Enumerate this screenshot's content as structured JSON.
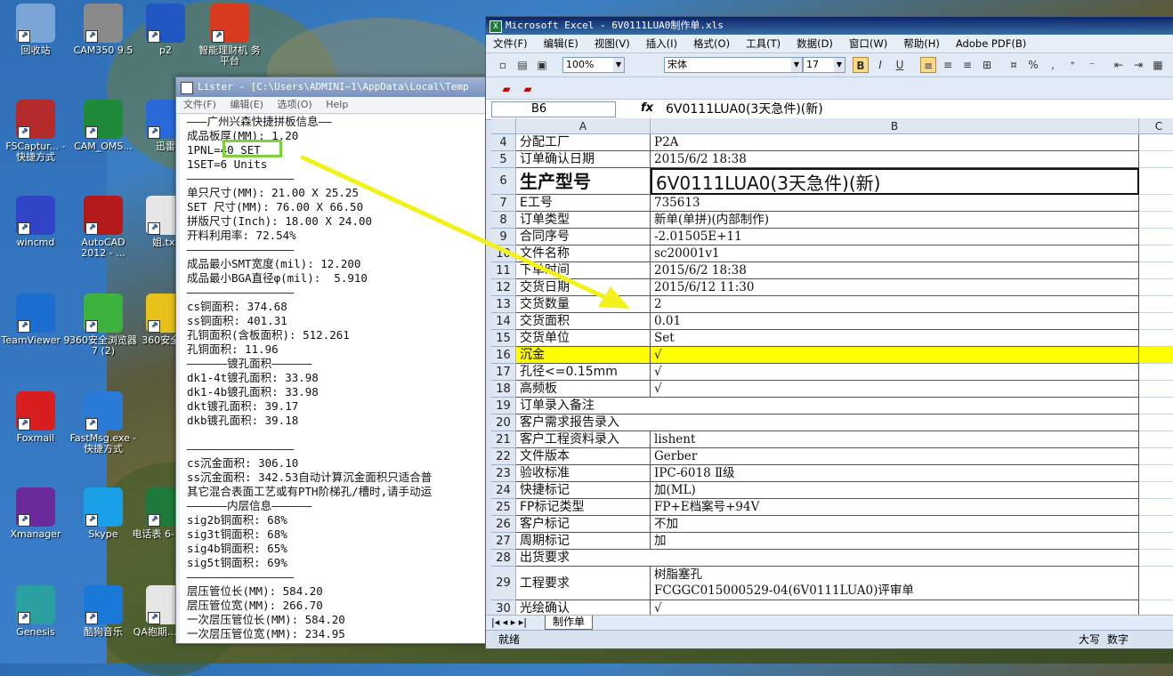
{
  "desktop": {
    "icons": [
      {
        "label": "回收站",
        "icon": "recycle-bin-icon"
      },
      {
        "label": "CAM350 9.5",
        "icon": "cam350-icon"
      },
      {
        "label": "p2",
        "icon": "globe-icon"
      },
      {
        "label": "智能理财机 务平台",
        "icon": "finance-icon"
      },
      {
        "label": "FSCaptur... - 快捷方式",
        "icon": "fscapture-icon"
      },
      {
        "label": "CAM_OMS...",
        "icon": "cam-oms-icon"
      },
      {
        "label": "迅雷",
        "icon": "xunlei-icon"
      },
      {
        "label": "wincmd",
        "icon": "floppy-icon"
      },
      {
        "label": "AutoCAD 2012 - ...",
        "icon": "autocad-icon"
      },
      {
        "label": "姐.txt",
        "icon": "text-file-icon"
      },
      {
        "label": "TeamViewer 9",
        "icon": "teamviewer-icon"
      },
      {
        "label": "360安全浏览器7 (2)",
        "icon": "browser-360-icon"
      },
      {
        "label": "360安全...",
        "icon": "security-360-icon"
      },
      {
        "label": "Foxmail",
        "icon": "foxmail-icon"
      },
      {
        "label": "FastMsg.exe - 快捷方式",
        "icon": "fastmsg-icon"
      },
      {
        "label": "Xmanager",
        "icon": "xmanager-icon"
      },
      {
        "label": "Skype",
        "icon": "skype-icon"
      },
      {
        "label": "电话表 6-3.x...",
        "icon": "excel-file-icon"
      },
      {
        "label": "Genesis",
        "icon": "genesis-icon"
      },
      {
        "label": "酷狗音乐",
        "icon": "kugou-icon"
      },
      {
        "label": "QA抱期... .jpg",
        "icon": "jpg-file-icon"
      }
    ]
  },
  "lister": {
    "title": "Lister - [C:\\Users\\ADMINI~1\\AppData\\Local\\Temp",
    "menu": [
      "文件(F)",
      "编辑(E)",
      "选项(O)",
      "Help"
    ],
    "lines": [
      "———广州兴森快捷拼板信息——",
      "成品板厚(MM): 1.20",
      "1PNL=40 SET",
      "1SET=6 Units",
      "————————————————",
      "单只尺寸(MM): 21.00 X 25.25",
      "SET 尺寸(MM): 76.00 X 66.50",
      "拼版尺寸(Inch): 18.00 X 24.00",
      "开料利用率: 72.54%",
      "————————————————",
      "成品最小SMT宽度(mil): 12.200",
      "成品最小BGA直径φ(mil):  5.910",
      "————————————————",
      "cs铜面积: 374.68",
      "ss铜面积: 401.31",
      "孔铜面积(含板面积): 512.261",
      "孔铜面积: 11.96",
      "——————镀孔面积——————",
      "dk1-4t镀孔面积: 33.98",
      "dk1-4b镀孔面积: 33.98",
      "dkt镀孔面积: 39.17",
      "dkb镀孔面积: 39.18",
      "",
      "————————————————",
      "cs沉金面积: 306.10",
      "ss沉金面积: 342.53自动计算沉金面积只适合普",
      "其它混合表面工艺或有PTH阶梯孔/槽时,请手动运",
      "——————内层信息——————",
      "sig2b铜面积: 68%",
      "sig3t铜面积: 68%",
      "sig4b铜面积: 65%",
      "sig5t铜面积: 69%",
      "————————————————",
      "层压管位长(MM): 584.20",
      "层压管位宽(MM): 266.70",
      "一次层压管位长(MM): 584.20",
      "一次层压管位宽(MM): 234.95"
    ]
  },
  "excel": {
    "title": "Microsoft Excel - 6V0111LUA0制作单.xls",
    "menu": [
      "文件(F)",
      "编辑(E)",
      "视图(V)",
      "插入(I)",
      "格式(O)",
      "工具(T)",
      "数据(D)",
      "窗口(W)",
      "帮助(H)",
      "Adobe PDF(B)"
    ],
    "zoom": "100%",
    "font_name": "宋体",
    "font_size": "17",
    "name_box": "B6",
    "fx": "fx",
    "formula": "6V0111LUA0(3天急件)(新)",
    "col_a": "A",
    "col_b": "B",
    "col_c": "C",
    "rows": [
      {
        "n": "4",
        "a": "分配工厂",
        "b": "P2A"
      },
      {
        "n": "5",
        "a": "订单确认日期",
        "b": "2015/6/2 18:38"
      },
      {
        "n": "6",
        "a": "生产型号",
        "b": "6V0111LUA0(3天急件)(新)"
      },
      {
        "n": "7",
        "a": "E工号",
        "b": "735613"
      },
      {
        "n": "8",
        "a": "订单类型",
        "b": "新单(单拼)(内部制作)"
      },
      {
        "n": "9",
        "a": "合同序号",
        "b": "-2.01505E+11"
      },
      {
        "n": "10",
        "a": "文件名称",
        "b": "sc20001v1"
      },
      {
        "n": "11",
        "a": "下单时间",
        "b": "2015/6/2 18:38"
      },
      {
        "n": "12",
        "a": "交货日期",
        "b": "2015/6/12 11:30"
      },
      {
        "n": "13",
        "a": "交货数量",
        "b": "2"
      },
      {
        "n": "14",
        "a": "交货面积",
        "b": "0.01"
      },
      {
        "n": "15",
        "a": "交货单位",
        "b": "Set"
      },
      {
        "n": "16",
        "a": "沉金",
        "b": "√"
      },
      {
        "n": "17",
        "a": "孔径<=0.15mm",
        "b": "√"
      },
      {
        "n": "18",
        "a": "高频板",
        "b": "√"
      },
      {
        "n": "19",
        "a": "订单录入备注",
        "b": ""
      },
      {
        "n": "20",
        "a": "客户需求报告录入",
        "b": ""
      },
      {
        "n": "21",
        "a": "客户工程资料录入",
        "b": "lishent"
      },
      {
        "n": "22",
        "a": "文件版本",
        "b": "Gerber"
      },
      {
        "n": "23",
        "a": "验收标准",
        "b": "IPC-6018 Ⅱ级"
      },
      {
        "n": "24",
        "a": "快捷标记",
        "b": "加(ML)"
      },
      {
        "n": "25",
        "a": "FP标记类型",
        "b": "FP+E档案号+94V"
      },
      {
        "n": "26",
        "a": "客户标记",
        "b": "不加"
      },
      {
        "n": "27",
        "a": "周期标记",
        "b": "加"
      },
      {
        "n": "28",
        "a": "出货要求",
        "b": ""
      },
      {
        "n": "29",
        "a": "工程要求",
        "b": "树脂塞孔",
        "b2": "FCGGC015000529-04(6V0111LUA0)评审单"
      },
      {
        "n": "30",
        "a": "光绘确认",
        "b": "√"
      }
    ],
    "sheet_tab": "制作单",
    "status_left": "就绪",
    "status_caps": "大写",
    "status_num": "数字"
  },
  "colors": {
    "highlight_row": "#ffff00",
    "annotation_arrow": "#f2f21a",
    "annotation_box": "#7dd13c"
  }
}
